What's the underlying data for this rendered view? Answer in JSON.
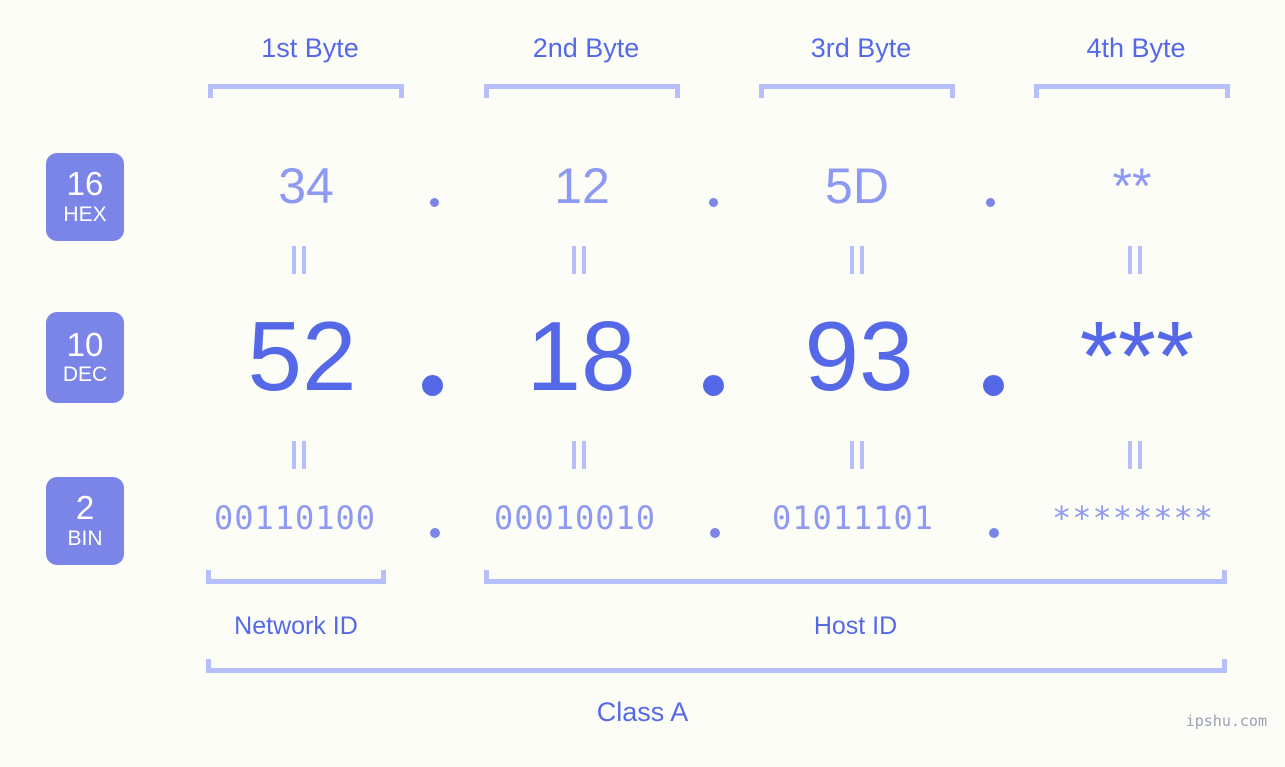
{
  "background_color": "#fdfdf8",
  "accent_color": "#5569e8",
  "accent_light_color": "#8d99f2",
  "bracket_color": "#b6bffa",
  "badge_color": "#7b85e8",
  "header": {
    "byte_labels": [
      "1st Byte",
      "2nd Byte",
      "3rd Byte",
      "4th Byte"
    ]
  },
  "rows": [
    {
      "base_number": "16",
      "base_abbr": "HEX",
      "values": [
        "34",
        "12",
        "5D",
        "**"
      ],
      "separator": "."
    },
    {
      "base_number": "10",
      "base_abbr": "DEC",
      "values": [
        "52",
        "18",
        "93",
        "***"
      ],
      "separator": "."
    },
    {
      "base_number": "2",
      "base_abbr": "BIN",
      "values": [
        "00110100",
        "00010010",
        "01011101",
        "********"
      ],
      "separator": "."
    }
  ],
  "equals_marker": "||",
  "footer": {
    "network_id_label": "Network ID",
    "host_id_label": "Host ID",
    "class_label": "Class A",
    "watermark": "ipshu.com"
  }
}
